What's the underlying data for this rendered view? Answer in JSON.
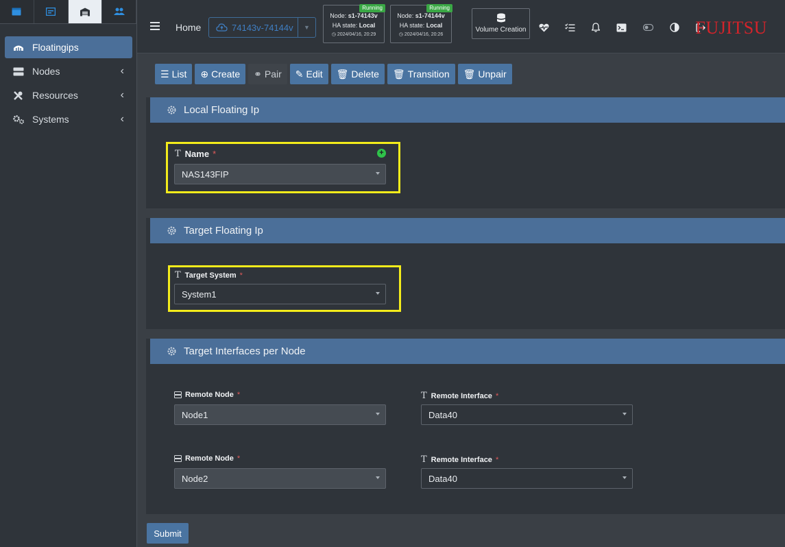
{
  "sidebar": {
    "tabs": [
      {
        "icon": "window-icon"
      },
      {
        "icon": "id-card-icon"
      },
      {
        "icon": "warehouse-icon"
      },
      {
        "icon": "users-icon"
      }
    ],
    "items": [
      {
        "label": "Floatingips",
        "icon": "network-icon"
      },
      {
        "label": "Nodes",
        "icon": "server-icon"
      },
      {
        "label": "Resources",
        "icon": "tools-icon"
      },
      {
        "label": "Systems",
        "icon": "cogs-icon"
      }
    ]
  },
  "topbar": {
    "home": "Home",
    "cluster": "74143v-74144v",
    "nodes": [
      {
        "node_prefix": "Node: ",
        "node": "s1-74143v",
        "ha_prefix": "HA state: ",
        "ha": "Local",
        "time": "2024/04/16, 20:29",
        "status": "Running"
      },
      {
        "node_prefix": "Node: ",
        "node": "s1-74144v",
        "ha_prefix": "HA state: ",
        "ha": "Local",
        "time": "2024/04/16, 20:26",
        "status": "Running"
      }
    ],
    "volume_creation": "Volume Creation",
    "brand": "FUJITSU"
  },
  "toolbar": {
    "list": "List",
    "create": "Create",
    "pair": "Pair",
    "edit": "Edit",
    "delete": "Delete",
    "transition": "Transition",
    "unpair": "Unpair"
  },
  "local_panel": {
    "title": "Local Floating Ip",
    "name_label": "Name",
    "name_value": "NAS143FIP"
  },
  "target_panel": {
    "title": "Target Floating Ip",
    "system_label": "Target System",
    "system_value": "System1"
  },
  "interfaces_panel": {
    "title": "Target Interfaces per Node",
    "rows": [
      {
        "node_label": "Remote Node",
        "node_value": "Node1",
        "iface_label": "Remote Interface",
        "iface_value": "Data40"
      },
      {
        "node_label": "Remote Node",
        "node_value": "Node2",
        "iface_label": "Remote Interface",
        "iface_value": "Data40"
      }
    ]
  },
  "required_mark": "*",
  "submit": "Submit",
  "colors": {
    "accent": "#4b6f99",
    "highlight": "#f4ec1b",
    "brand": "#d4232a",
    "running": "#3aa845"
  }
}
